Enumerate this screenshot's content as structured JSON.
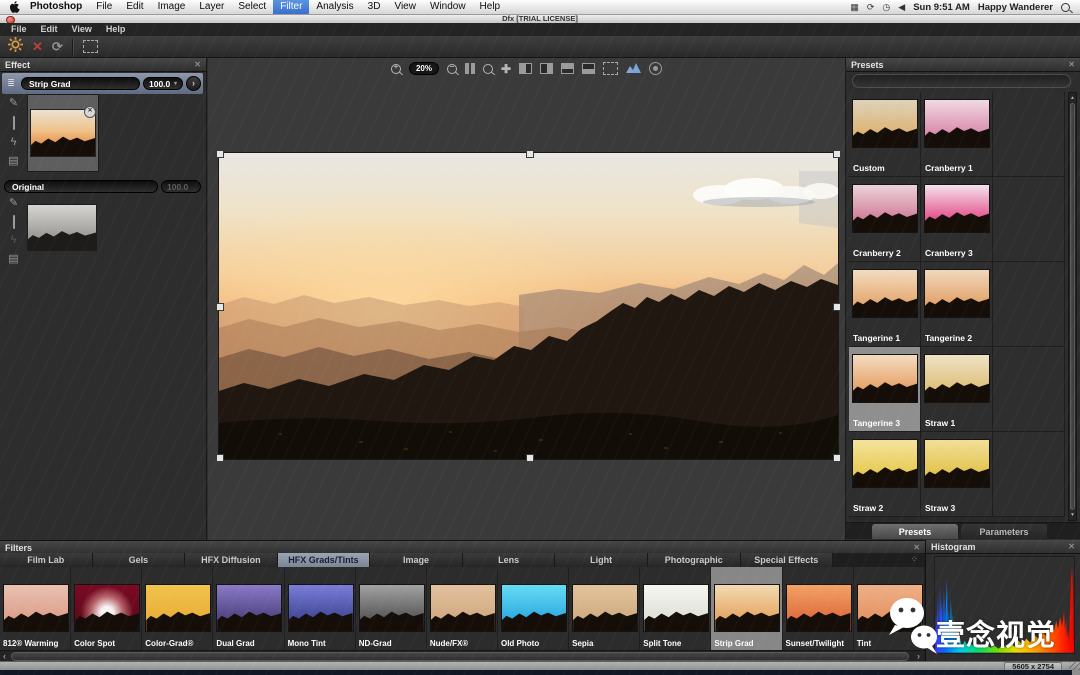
{
  "icons": {
    "close": "✕",
    "panel_close": "✕",
    "refresh": "⟳",
    "edit": "✎",
    "lightning": "ϟ",
    "layers": "▤",
    "stack": "≣",
    "pan": "✚",
    "dropdown": "▾",
    "chevron_right": "›",
    "arrow_left": "‹",
    "arrow_right": "›",
    "arrow_up": "▲",
    "arrow_down": "▼",
    "grid_dots": "⁘",
    "display": "▦",
    "sync": "⟳",
    "clock": "◷",
    "volume": "◀"
  },
  "macos_menubar": {
    "menus": [
      {
        "label": "Photoshop",
        "bold": true
      },
      {
        "label": "File"
      },
      {
        "label": "Edit"
      },
      {
        "label": "Image"
      },
      {
        "label": "Layer"
      },
      {
        "label": "Select"
      },
      {
        "label": "Filter",
        "active": true
      },
      {
        "label": "Analysis"
      },
      {
        "label": "3D"
      },
      {
        "label": "View"
      },
      {
        "label": "Window"
      },
      {
        "label": "Help"
      }
    ],
    "time": "Sun 9:51 AM",
    "user": "Happy Wanderer"
  },
  "window_titlebar": {
    "title": "Dfx [TRIAL LICENSE]"
  },
  "app_menubar": {
    "menus": [
      "File",
      "Edit",
      "View",
      "Help"
    ]
  },
  "effect_panel": {
    "title": "Effect",
    "effect": {
      "name": "Strip Grad",
      "value": "100.0"
    },
    "original": {
      "name": "Original",
      "value": "100.0"
    }
  },
  "viewer": {
    "zoom_level": "20%"
  },
  "presets_panel": {
    "title": "Presets",
    "tabs": [
      "Presets",
      "Parameters"
    ],
    "active_tab": "Presets",
    "selected_preset": "Tangerine 3",
    "presets": [
      {
        "name": "Custom",
        "sky_top": "#ddd2ba",
        "sky_bottom": "#dfa757"
      },
      {
        "name": "Cranberry 1",
        "sky_top": "#f0d9e2",
        "sky_bottom": "#d06b97"
      },
      {
        "name": "Cranberry 2",
        "sky_top": "#ecd4da",
        "sky_bottom": "#c75b80"
      },
      {
        "name": "Cranberry 3",
        "sky_top": "#f5e2ec",
        "sky_bottom": "#dd1a68"
      },
      {
        "name": "Tangerine 1",
        "sky_top": "#f2dcc0",
        "sky_bottom": "#e09450"
      },
      {
        "name": "Tangerine 2",
        "sky_top": "#f0d8bc",
        "sky_bottom": "#dd8e4c"
      },
      {
        "name": "Tangerine 3",
        "sky_top": "#f4dcc0",
        "sky_bottom": "#e08b44"
      },
      {
        "name": "Straw 1",
        "sky_top": "#efe2c4",
        "sky_bottom": "#d8b35e"
      },
      {
        "name": "Straw 2",
        "sky_top": "#f4e39e",
        "sky_bottom": "#e2c132"
      },
      {
        "name": "Straw 3",
        "sky_top": "#f2df98",
        "sky_bottom": "#dcb82e"
      }
    ]
  },
  "filters_panel": {
    "title": "Filters",
    "tabs": [
      "Film Lab",
      "Gels",
      "HFX Diffusion",
      "HFX Grads/Tints",
      "Image",
      "Lens",
      "Light",
      "Photographic",
      "Special Effects"
    ],
    "active_tab": "HFX Grads/Tints",
    "selected_filter": "Strip Grad",
    "filters": [
      {
        "name": "812® Warming",
        "sky_top": "#e9c2b0",
        "sky_bottom": "#d8917e"
      },
      {
        "name": "Color Spot",
        "sky_top": "#7a0a24",
        "sky_bottom": "#5a0618",
        "glow": true
      },
      {
        "name": "Color-Grad®",
        "sky_top": "#f0c44e",
        "sky_bottom": "#e8a62e"
      },
      {
        "name": "Dual Grad",
        "sky_top": "#8a7ac8",
        "sky_bottom": "#3a2f66"
      },
      {
        "name": "Mono Tint",
        "sky_top": "#7a7ed8",
        "sky_bottom": "#2d3380"
      },
      {
        "name": "ND-Grad",
        "sky_top": "#a2a2a2",
        "sky_bottom": "#3c3c3c"
      },
      {
        "name": "Nude/FX®",
        "sky_top": "#e3c29e",
        "sky_bottom": "#caa075"
      },
      {
        "name": "Old Photo",
        "sky_top": "#66dcf4",
        "sky_bottom": "#1a9ada"
      },
      {
        "name": "Sepia",
        "sky_top": "#e2c49c",
        "sky_bottom": "#c9a276"
      },
      {
        "name": "Split Tone",
        "sky_top": "#f6f6f2",
        "sky_bottom": "#d8d8d0"
      },
      {
        "name": "Strip Grad",
        "sky_top": "#f2dab2",
        "sky_bottom": "#e09446"
      },
      {
        "name": "Sunset/Twilight",
        "sky_top": "#f2a266",
        "sky_bottom": "#d85a2e"
      },
      {
        "name": "Tint",
        "sky_top": "#eeb086",
        "sky_bottom": "#e08a58"
      }
    ]
  },
  "histogram_panel": {
    "title": "Histogram"
  },
  "status_bar": {
    "dimensions": "5605 x 2754"
  },
  "watermark": {
    "text": "壹念视觉"
  }
}
